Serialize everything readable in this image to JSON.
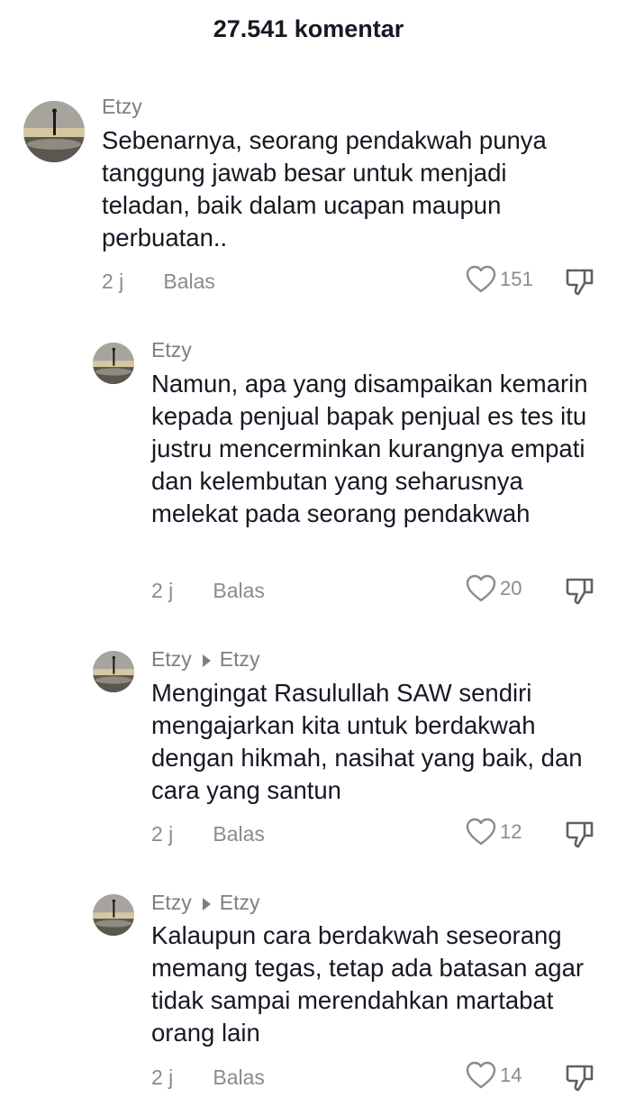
{
  "header": {
    "title": "27.541 komentar"
  },
  "comments": [
    {
      "author": "Etzy",
      "reply_to": "",
      "text": "Sebenarnya, seorang pendakwah punya tanggung jawab besar untuk menjadi teladan, baik dalam ucapan maupun perbuatan..",
      "time": "2 j",
      "reply_label": "Balas",
      "likes": "151"
    },
    {
      "author": "Etzy",
      "reply_to": "",
      "text": "Namun, apa yang disampaikan kemarin kepada penjual bapak penjual es tes itu justru mencerminkan kurangnya empati dan kelembutan yang seharusnya melekat pada seorang pendakwah",
      "time": "2 j",
      "reply_label": "Balas",
      "likes": "20"
    },
    {
      "author": "Etzy",
      "reply_to": "Etzy",
      "text": "Mengingat Rasulullah SAW sendiri mengajarkan kita untuk berdakwah dengan hikmah, nasihat yang baik, dan cara yang santun",
      "time": "2 j",
      "reply_label": "Balas",
      "likes": "12"
    },
    {
      "author": "Etzy",
      "reply_to": "Etzy",
      "text": "Kalaupun cara berdakwah seseorang memang tegas, tetap ada batasan agar tidak sampai merendahkan martabat orang lain",
      "time": "2 j",
      "reply_label": "Balas",
      "likes": "14"
    }
  ]
}
